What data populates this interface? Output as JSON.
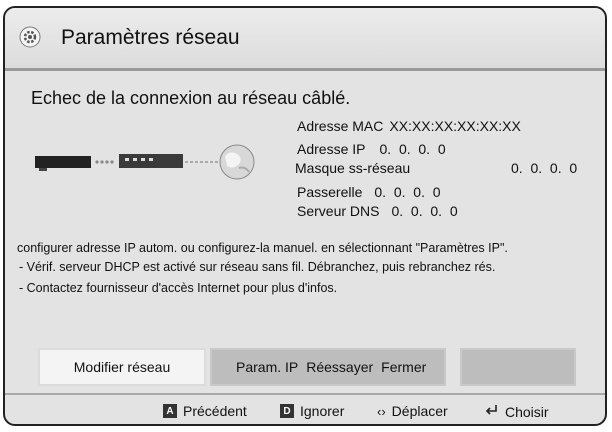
{
  "title": "Paramètres réseau",
  "headline": "Echec de la connexion au réseau câblé.",
  "network": {
    "mac_label": "Adresse MAC",
    "mac_value": "XX:XX:XX:XX:XX:XX",
    "ip_label": "Adresse IP",
    "ip_value": "0.  0.  0.  0",
    "mask_label": "Masque ss-réseau",
    "mask_value": "0.  0.  0.  0",
    "gateway_label": "Passerelle",
    "gateway_value": "0.  0.  0.  0",
    "dns_label": "Serveur DNS",
    "dns_value": "0.  0.  0.  0"
  },
  "messages": [
    "configurer adresse IP autom. ou configurez-la manuel. en sélectionnant \"Paramètres IP\".",
    "- Vérif. serveur DHCP est activé sur réseau sans fil. Débranchez, puis rebranchez rés.",
    "- Contactez fournisseur d'accès Internet pour plus d'infos."
  ],
  "buttons": {
    "modify": "Modifier réseau",
    "ip_settings": "Param. IP",
    "retry": "Réessayer",
    "close": "Fermer"
  },
  "footer": {
    "a_key": "A",
    "a_label": "Précédent",
    "d_key": "D",
    "d_label": "Ignorer",
    "move_symbol": "‹›",
    "move_label": "Déplacer",
    "enter_label": "Choisir"
  },
  "colors": {
    "panel": "#e3e3e3",
    "button": "#bdbdbd",
    "button_selected": "#f4f4f4"
  }
}
